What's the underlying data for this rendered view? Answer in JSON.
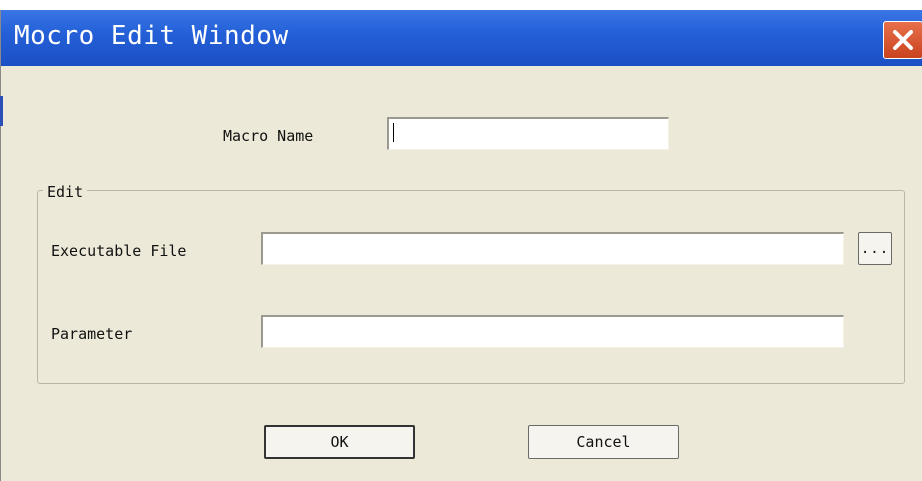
{
  "window": {
    "title": "Mocro Edit Window"
  },
  "form": {
    "macro_name_label": "Macro Name",
    "macro_name_value": "",
    "group_title": "Edit",
    "executable_label": "Executable File",
    "executable_value": "",
    "browse_label": "...",
    "parameter_label": "Parameter",
    "parameter_value": ""
  },
  "buttons": {
    "ok": "OK",
    "cancel": "Cancel"
  },
  "icons": {
    "close": "close-x-icon"
  },
  "colors": {
    "titlebar": "#2460d8",
    "close_button": "#d9532b",
    "window_bg": "#ece9d8"
  }
}
